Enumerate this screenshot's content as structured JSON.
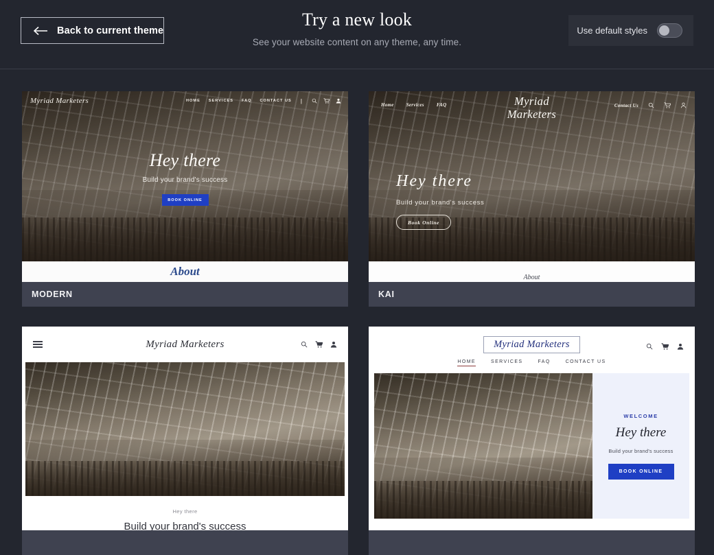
{
  "header": {
    "back_button": "Back to current theme",
    "back_icon": "arrow-left-icon",
    "title": "Try a new look",
    "subtitle": "See your website content on any theme, any time.",
    "toggle_label": "Use default styles",
    "toggle_state": "off"
  },
  "colors": {
    "page_bg": "#23262f",
    "label_bar": "#3f4250",
    "accent_blue": "#1f3fc4",
    "about_blue": "#2b4a8c",
    "logo_blue": "#23307c",
    "panel_lavender": "#eef1fb"
  },
  "brand": {
    "name": "Myriad Marketers",
    "name_line1": "Myriad",
    "name_line2": "Marketers"
  },
  "themes": [
    {
      "label": "MODERN",
      "nav": {
        "links": [
          "HOME",
          "SERVICES",
          "FAQ",
          "CONTACT US"
        ],
        "separator": "|",
        "icons": [
          "search-icon",
          "cart-icon",
          "account-icon"
        ]
      },
      "hero": {
        "title": "Hey there",
        "subtitle": "Build your brand's success",
        "button": "BOOK ONLINE"
      },
      "section": "About"
    },
    {
      "label": "KAI",
      "nav": {
        "links_left": [
          "Home",
          "Services",
          "FAQ"
        ],
        "links_right": [
          "Contact Us"
        ],
        "icons": [
          "search-icon",
          "cart-icon",
          "account-icon"
        ]
      },
      "hero": {
        "title": "Hey there",
        "subtitle": "Build your brand's success",
        "button": "Book Online"
      },
      "section": "About"
    },
    {
      "label": "",
      "nav": {
        "menu_icon": "hamburger-icon",
        "icons": [
          "search-icon",
          "cart-icon",
          "account-icon"
        ]
      },
      "hero": {
        "kicker": "Hey there",
        "heading": "Build your brand's success"
      }
    },
    {
      "label": "",
      "nav": {
        "links": [
          "HOME",
          "SERVICES",
          "FAQ",
          "CONTACT US"
        ],
        "active_link": "HOME",
        "icons": [
          "search-icon",
          "cart-icon",
          "account-icon"
        ]
      },
      "hero": {
        "kicker": "WELCOME",
        "title": "Hey there",
        "subtitle": "Build your brand's success",
        "button": "BOOK ONLINE"
      }
    }
  ]
}
